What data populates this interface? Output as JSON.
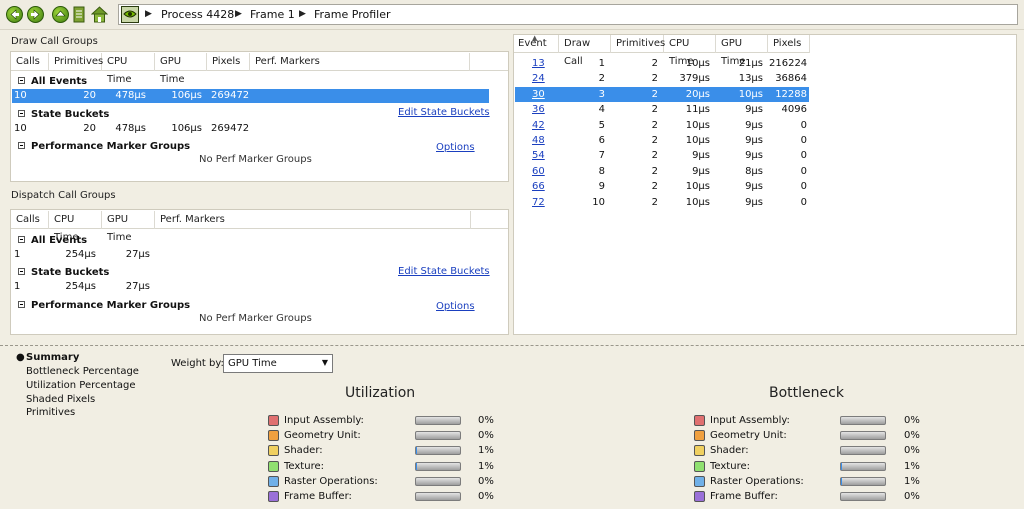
{
  "breadcrumb": [
    "Process 4428",
    "Frame 1",
    "Frame Profiler"
  ],
  "draw_call_groups": {
    "title": "Draw Call Groups",
    "columns": [
      "Calls",
      "Primitives",
      "CPU Time",
      "GPU Time",
      "Pixels",
      "Perf. Markers"
    ],
    "all_events": {
      "label": "All Events",
      "row": [
        "10",
        "20",
        "478µs",
        "106µs",
        "269472"
      ]
    },
    "state_buckets": {
      "label": "State Buckets",
      "link": "Edit State Buckets",
      "row": [
        "10",
        "20",
        "478µs",
        "106µs",
        "269472"
      ]
    },
    "perf_groups": {
      "label": "Performance Marker Groups",
      "link": "Options",
      "empty": "No Perf Marker Groups"
    }
  },
  "dispatch_call_groups": {
    "title": "Dispatch Call Groups",
    "columns": [
      "Calls",
      "CPU Time",
      "GPU Time",
      "Perf. Markers"
    ],
    "all_events": {
      "label": "All Events",
      "row": [
        "1",
        "254µs",
        "27µs"
      ]
    },
    "state_buckets": {
      "label": "State Buckets",
      "link": "Edit State Buckets",
      "row": [
        "1",
        "254µs",
        "27µs"
      ]
    },
    "perf_groups": {
      "label": "Performance Marker Groups",
      "link": "Options",
      "empty": "No Perf Marker Groups"
    }
  },
  "events": {
    "columns": [
      "Event",
      "Draw Call",
      "Primitives",
      "CPU Time",
      "GPU Time",
      "Pixels"
    ],
    "rows": [
      [
        "13",
        "1",
        "2",
        "10µs",
        "21µs",
        "216224"
      ],
      [
        "24",
        "2",
        "2",
        "379µs",
        "13µs",
        "36864"
      ],
      [
        "30",
        "3",
        "2",
        "20µs",
        "10µs",
        "12288"
      ],
      [
        "36",
        "4",
        "2",
        "11µs",
        "9µs",
        "4096"
      ],
      [
        "42",
        "5",
        "2",
        "10µs",
        "9µs",
        "0"
      ],
      [
        "48",
        "6",
        "2",
        "10µs",
        "9µs",
        "0"
      ],
      [
        "54",
        "7",
        "2",
        "9µs",
        "9µs",
        "0"
      ],
      [
        "60",
        "8",
        "2",
        "9µs",
        "8µs",
        "0"
      ],
      [
        "66",
        "9",
        "2",
        "10µs",
        "9µs",
        "0"
      ],
      [
        "72",
        "10",
        "2",
        "10µs",
        "9µs",
        "0"
      ]
    ],
    "selected_index": 2
  },
  "sidebar": {
    "selected": "Summary",
    "items": [
      "Bottleneck Percentage",
      "Utilization Percentage",
      "Shaded Pixels",
      "Primitives"
    ]
  },
  "weight_by": {
    "label": "Weight by:",
    "value": "GPU Time"
  },
  "utilization": {
    "title": "Utilization",
    "items": [
      {
        "label": "Input Assembly:",
        "pct": "0%",
        "value": 0,
        "color": "#e07070"
      },
      {
        "label": "Geometry Unit:",
        "pct": "0%",
        "value": 0,
        "color": "#f0a040"
      },
      {
        "label": "Shader:",
        "pct": "1%",
        "value": 1,
        "color": "#f0d060"
      },
      {
        "label": "Texture:",
        "pct": "1%",
        "value": 1,
        "color": "#90e070"
      },
      {
        "label": "Raster Operations:",
        "pct": "0%",
        "value": 0,
        "color": "#70b0e8"
      },
      {
        "label": "Frame Buffer:",
        "pct": "0%",
        "value": 0,
        "color": "#9a70d8"
      }
    ]
  },
  "bottleneck": {
    "title": "Bottleneck",
    "items": [
      {
        "label": "Input Assembly:",
        "pct": "0%",
        "value": 0,
        "color": "#e07070"
      },
      {
        "label": "Geometry Unit:",
        "pct": "0%",
        "value": 0,
        "color": "#f0a040"
      },
      {
        "label": "Shader:",
        "pct": "0%",
        "value": 0,
        "color": "#f0d060"
      },
      {
        "label": "Texture:",
        "pct": "1%",
        "value": 1,
        "color": "#90e070"
      },
      {
        "label": "Raster Operations:",
        "pct": "1%",
        "value": 1,
        "color": "#70b0e8"
      },
      {
        "label": "Frame Buffer:",
        "pct": "0%",
        "value": 0,
        "color": "#9a70d8"
      }
    ]
  },
  "colors": {
    "selection": "#3a8ee9",
    "link": "#1a3fbf"
  }
}
